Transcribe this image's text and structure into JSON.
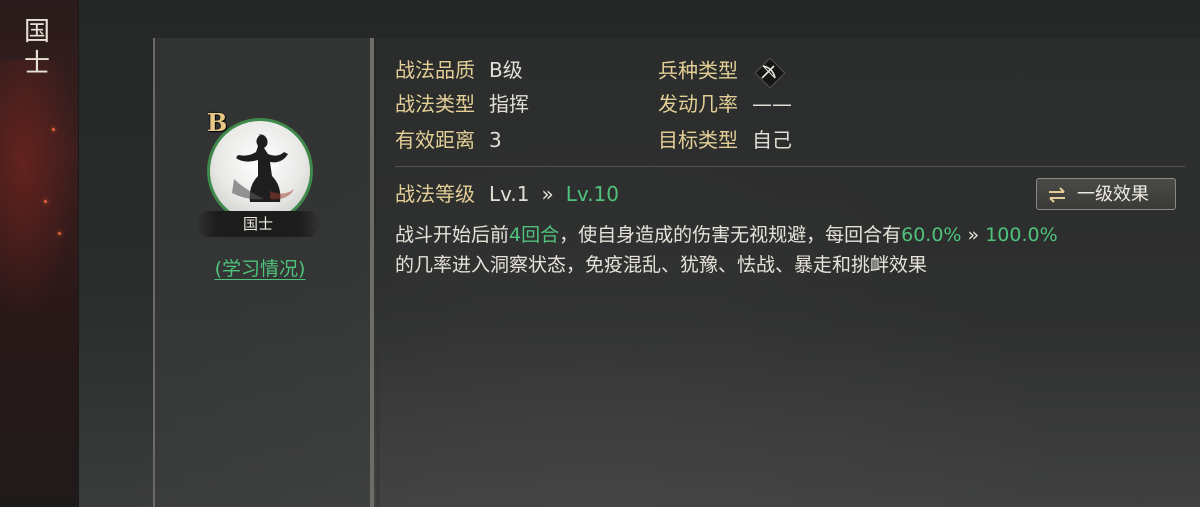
{
  "strip": {
    "title": "国士"
  },
  "tactic": {
    "grade_letter": "B",
    "name": "国士",
    "learn_link": "(学习情况)"
  },
  "attributes": {
    "quality": {
      "label": "战法品质",
      "value": "B级"
    },
    "type": {
      "label": "战法类型",
      "value": "指挥"
    },
    "range": {
      "label": "有效距离",
      "value": "3"
    },
    "arms": {
      "label": "兵种类型",
      "icon": "bow-icon"
    },
    "trigger": {
      "label": "发动几率",
      "value": "——"
    },
    "target": {
      "label": "目标类型",
      "value": "自己"
    }
  },
  "level": {
    "label": "战法等级",
    "current": "Lv.1",
    "arrow": "»",
    "max": "Lv.10",
    "effect_button": "一级效果"
  },
  "description": {
    "p1": "战斗开始后前",
    "p2": "4回合",
    "p3": "，使自身造成的伤害无视规避，每回合有",
    "p4": "60.0%",
    "p5": " » ",
    "p6": "100.0%",
    "p7": "的几率进入洞察状态，免疫混乱、犹豫、怯战、暴走和挑衅效果"
  },
  "colors": {
    "label_gold": "#e3cf96",
    "highlight_green": "#4fc27c",
    "text_light": "#e2ded6"
  }
}
